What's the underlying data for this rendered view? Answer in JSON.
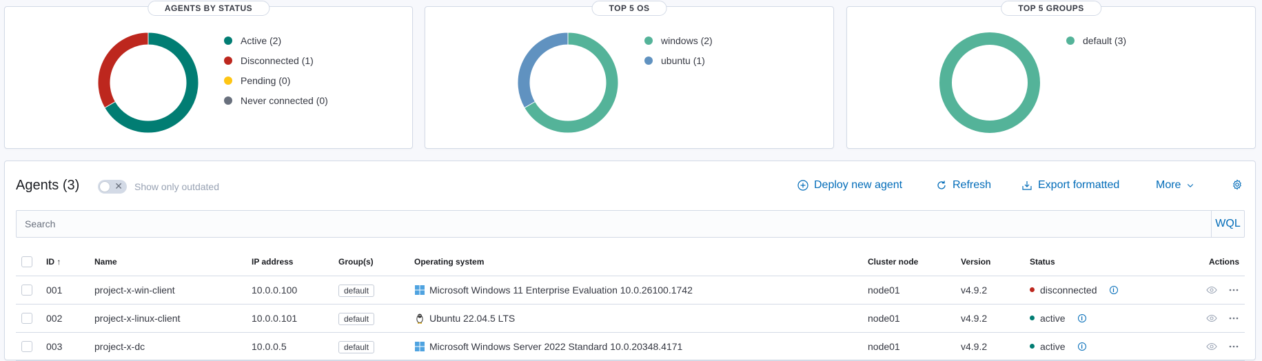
{
  "colors": {
    "active": "#017d73",
    "disconnected": "#bd271e",
    "pending": "#fec514",
    "never_connected": "#69707d",
    "windows": "#54b399",
    "ubuntu": "#6092c0",
    "default_group": "#54b399",
    "link": "#006bb8"
  },
  "panels": {
    "status": {
      "title": "AGENTS BY STATUS",
      "legend": [
        "Active (2)",
        "Disconnected (1)",
        "Pending (0)",
        "Never connected (0)"
      ]
    },
    "os": {
      "title": "TOP 5 OS",
      "legend": [
        "windows (2)",
        "ubuntu (1)"
      ]
    },
    "groups": {
      "title": "TOP 5 GROUPS",
      "legend": [
        "default (3)"
      ]
    }
  },
  "chart_data": [
    {
      "type": "pie",
      "title": "AGENTS BY STATUS",
      "categories": [
        "Active",
        "Disconnected",
        "Pending",
        "Never connected"
      ],
      "values": [
        2,
        1,
        0,
        0
      ],
      "colors": [
        "#017d73",
        "#bd271e",
        "#fec514",
        "#69707d"
      ]
    },
    {
      "type": "pie",
      "title": "TOP 5 OS",
      "categories": [
        "windows",
        "ubuntu"
      ],
      "values": [
        2,
        1
      ],
      "colors": [
        "#54b399",
        "#6092c0"
      ]
    },
    {
      "type": "pie",
      "title": "TOP 5 GROUPS",
      "categories": [
        "default"
      ],
      "values": [
        3
      ],
      "colors": [
        "#54b399"
      ]
    }
  ],
  "toolbar": {
    "title": "Agents (3)",
    "toggle_label": "Show only outdated",
    "deploy": "Deploy new agent",
    "refresh": "Refresh",
    "export": "Export formatted",
    "more": "More"
  },
  "search": {
    "placeholder": "Search",
    "wql": "WQL"
  },
  "table": {
    "headers": {
      "id": "ID",
      "name": "Name",
      "ip": "IP address",
      "groups": "Group(s)",
      "os": "Operating system",
      "node": "Cluster node",
      "version": "Version",
      "status": "Status",
      "actions": "Actions"
    },
    "rows": [
      {
        "id": "001",
        "name": "project-x-win-client",
        "ip": "10.0.0.100",
        "group": "default",
        "os_icon": "windows-icon",
        "os": "Microsoft Windows 11 Enterprise Evaluation 10.0.26100.1742",
        "node": "node01",
        "version": "v4.9.2",
        "status": "disconnected"
      },
      {
        "id": "002",
        "name": "project-x-linux-client",
        "ip": "10.0.0.101",
        "group": "default",
        "os_icon": "linux-icon",
        "os": "Ubuntu 22.04.5 LTS",
        "node": "node01",
        "version": "v4.9.2",
        "status": "active"
      },
      {
        "id": "003",
        "name": "project-x-dc",
        "ip": "10.0.0.5",
        "group": "default",
        "os_icon": "windows-icon",
        "os": "Microsoft Windows Server 2022 Standard 10.0.20348.4171",
        "node": "node01",
        "version": "v4.9.2",
        "status": "active"
      }
    ]
  }
}
